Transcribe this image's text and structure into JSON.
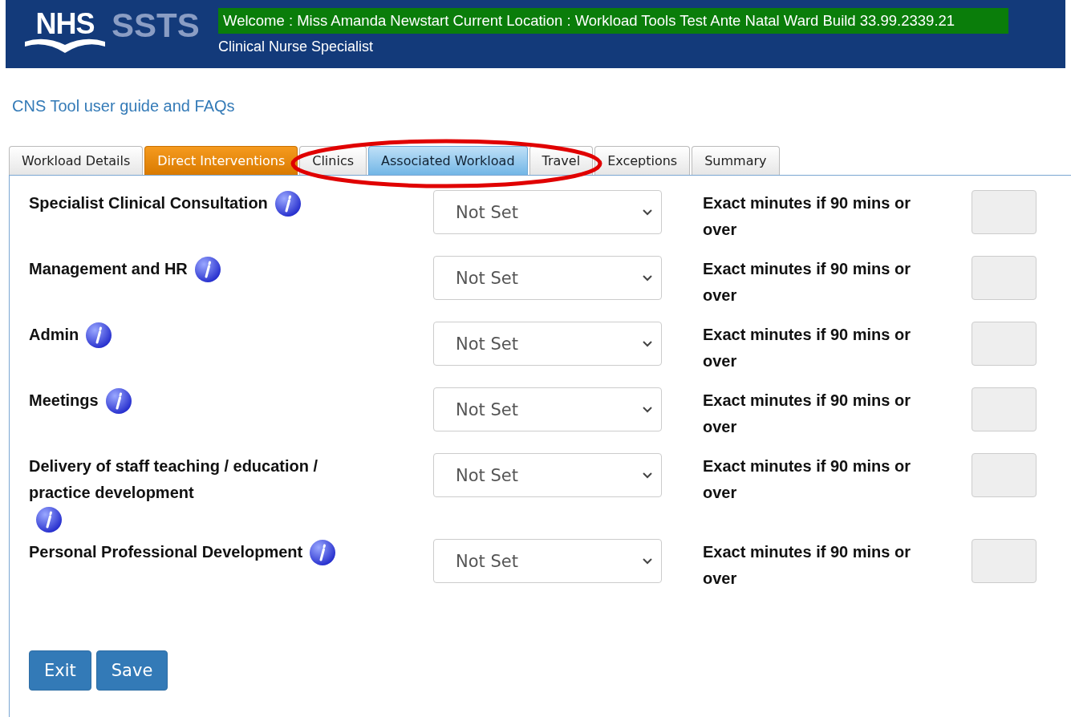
{
  "header": {
    "logo": "NHS",
    "product": "SSTS",
    "welcome": "Welcome : Miss Amanda Newstart Current Location : Workload Tools Test Ante Natal Ward Build 33.99.2339.21",
    "role": "Clinical Nurse Specialist"
  },
  "guide_link": "CNS Tool user guide and FAQs",
  "tabs": [
    {
      "label": "Workload Details",
      "selected": false,
      "highlighted": false
    },
    {
      "label": "Direct Interventions",
      "selected": true,
      "highlighted": false
    },
    {
      "label": "Clinics",
      "selected": false,
      "highlighted": false
    },
    {
      "label": "Associated Workload",
      "selected": false,
      "highlighted": true
    },
    {
      "label": "Travel",
      "selected": false,
      "highlighted": false
    },
    {
      "label": "Exceptions",
      "selected": false,
      "highlighted": false
    },
    {
      "label": "Summary",
      "selected": false,
      "highlighted": false
    }
  ],
  "rows": [
    {
      "label": "Specialist Clinical Consultation",
      "value": "Not Set",
      "minutes_label": "Exact minutes if 90 mins or over"
    },
    {
      "label": "Management and HR",
      "value": "Not Set",
      "minutes_label": "Exact minutes if 90 mins or over"
    },
    {
      "label": "Admin",
      "value": "Not Set",
      "minutes_label": "Exact minutes if 90 mins or over"
    },
    {
      "label": "Meetings",
      "value": "Not Set",
      "minutes_label": "Exact minutes if 90 mins or over"
    },
    {
      "label": "Delivery of staff teaching / education / practice development",
      "value": "Not Set",
      "minutes_label": "Exact minutes if 90 mins or over"
    },
    {
      "label": "Personal Professional Development",
      "value": "Not Set",
      "minutes_label": "Exact minutes if 90 mins or over"
    }
  ],
  "buttons": [
    "Exit",
    "Save"
  ]
}
